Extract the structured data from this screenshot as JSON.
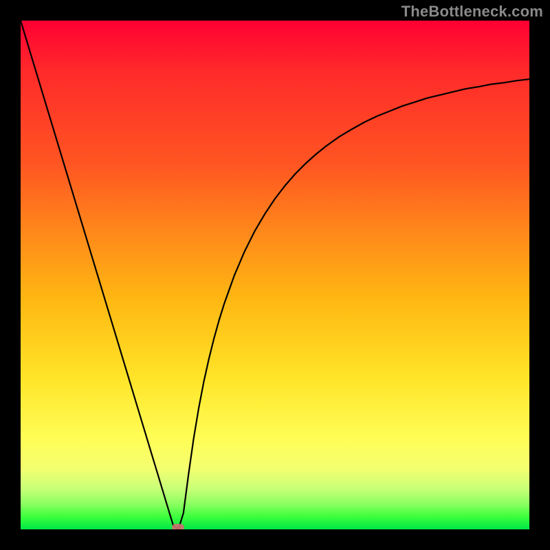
{
  "watermark": "TheBottleneck.com",
  "colors": {
    "frame": "#000000",
    "curve": "#000000",
    "watermark": "#8a8a8a",
    "gradient_top": "#ff0033",
    "gradient_bottom": "#00e648",
    "marker": "#d07070"
  },
  "chart_data": {
    "type": "line",
    "title": "",
    "xlabel": "",
    "ylabel": "",
    "xlim": [
      0,
      1
    ],
    "ylim": [
      0,
      1
    ],
    "min_point": {
      "x": 0.31,
      "y": 0.0
    },
    "series": [
      {
        "name": "curve",
        "x": [
          0.0,
          0.013,
          0.026,
          0.039,
          0.052,
          0.065,
          0.078,
          0.091,
          0.104,
          0.117,
          0.13,
          0.143,
          0.156,
          0.169,
          0.182,
          0.195,
          0.208,
          0.221,
          0.234,
          0.247,
          0.26,
          0.273,
          0.286,
          0.299,
          0.3,
          0.31,
          0.32,
          0.33,
          0.34,
          0.35,
          0.36,
          0.37,
          0.38,
          0.39,
          0.4,
          0.42,
          0.44,
          0.46,
          0.48,
          0.5,
          0.52,
          0.54,
          0.56,
          0.58,
          0.6,
          0.625,
          0.65,
          0.675,
          0.7,
          0.725,
          0.75,
          0.775,
          0.8,
          0.825,
          0.85,
          0.875,
          0.9,
          0.925,
          0.95,
          0.975,
          1.0
        ],
        "y": [
          1.0,
          0.957,
          0.914,
          0.871,
          0.828,
          0.785,
          0.742,
          0.699,
          0.656,
          0.613,
          0.57,
          0.527,
          0.484,
          0.441,
          0.398,
          0.355,
          0.312,
          0.269,
          0.226,
          0.183,
          0.14,
          0.097,
          0.054,
          0.011,
          0.008,
          0.0,
          0.032,
          0.108,
          0.178,
          0.238,
          0.29,
          0.335,
          0.375,
          0.411,
          0.443,
          0.499,
          0.546,
          0.586,
          0.62,
          0.65,
          0.676,
          0.699,
          0.719,
          0.737,
          0.753,
          0.771,
          0.786,
          0.8,
          0.812,
          0.822,
          0.832,
          0.84,
          0.848,
          0.854,
          0.86,
          0.866,
          0.87,
          0.875,
          0.878,
          0.882,
          0.885
        ]
      }
    ]
  }
}
